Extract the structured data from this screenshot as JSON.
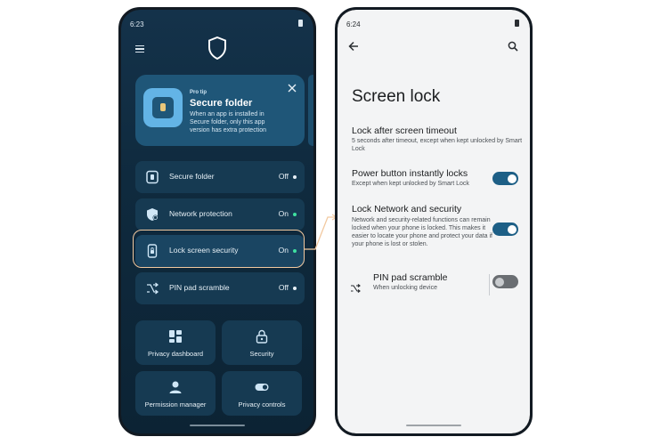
{
  "left_phone": {
    "status_time": "6:23",
    "protip": {
      "label": "Pro tip",
      "title": "Secure folder",
      "body": "When an app is installed in Secure folder, only this app version has extra protection"
    },
    "features": [
      {
        "label": "Secure folder",
        "status": "Off",
        "icon": "secure-folder-icon"
      },
      {
        "label": "Network protection",
        "status": "On",
        "icon": "network-shield-icon"
      },
      {
        "label": "Lock screen security",
        "status": "On",
        "icon": "lock-screen-icon"
      },
      {
        "label": "PIN pad scramble",
        "status": "Off",
        "icon": "shuffle-icon"
      }
    ],
    "tiles": [
      {
        "label": "Privacy dashboard",
        "icon": "dashboard-icon"
      },
      {
        "label": "Security",
        "icon": "lock-icon"
      },
      {
        "label": "Permission manager",
        "icon": "person-icon"
      },
      {
        "label": "Privacy controls",
        "icon": "toggle-icon"
      }
    ]
  },
  "right_phone": {
    "status_time": "6:24",
    "title": "Screen lock",
    "settings": [
      {
        "title": "Lock after screen timeout",
        "subtitle": "5 seconds after timeout, except when kept unlocked by Smart Lock"
      },
      {
        "title": "Power button instantly locks",
        "subtitle": "Except when kept unlocked by Smart Lock",
        "enabled": true
      },
      {
        "title": "Lock Network and security",
        "subtitle": "Network and security-related functions can remain locked when your phone is locked. This makes it easier to locate your phone and protect your data if your phone is lost or stolen.",
        "enabled": true
      },
      {
        "title": "PIN pad scramble",
        "subtitle": "When unlocking device",
        "enabled": false
      }
    ]
  },
  "colors": {
    "dark_bg": "#0f2a3e",
    "card": "#163a52",
    "accent_light": "#63b4e6",
    "toggle_on": "#1d5f86",
    "status_on_dot": "#3fe0a0",
    "highlight": "#f2c9a0"
  }
}
